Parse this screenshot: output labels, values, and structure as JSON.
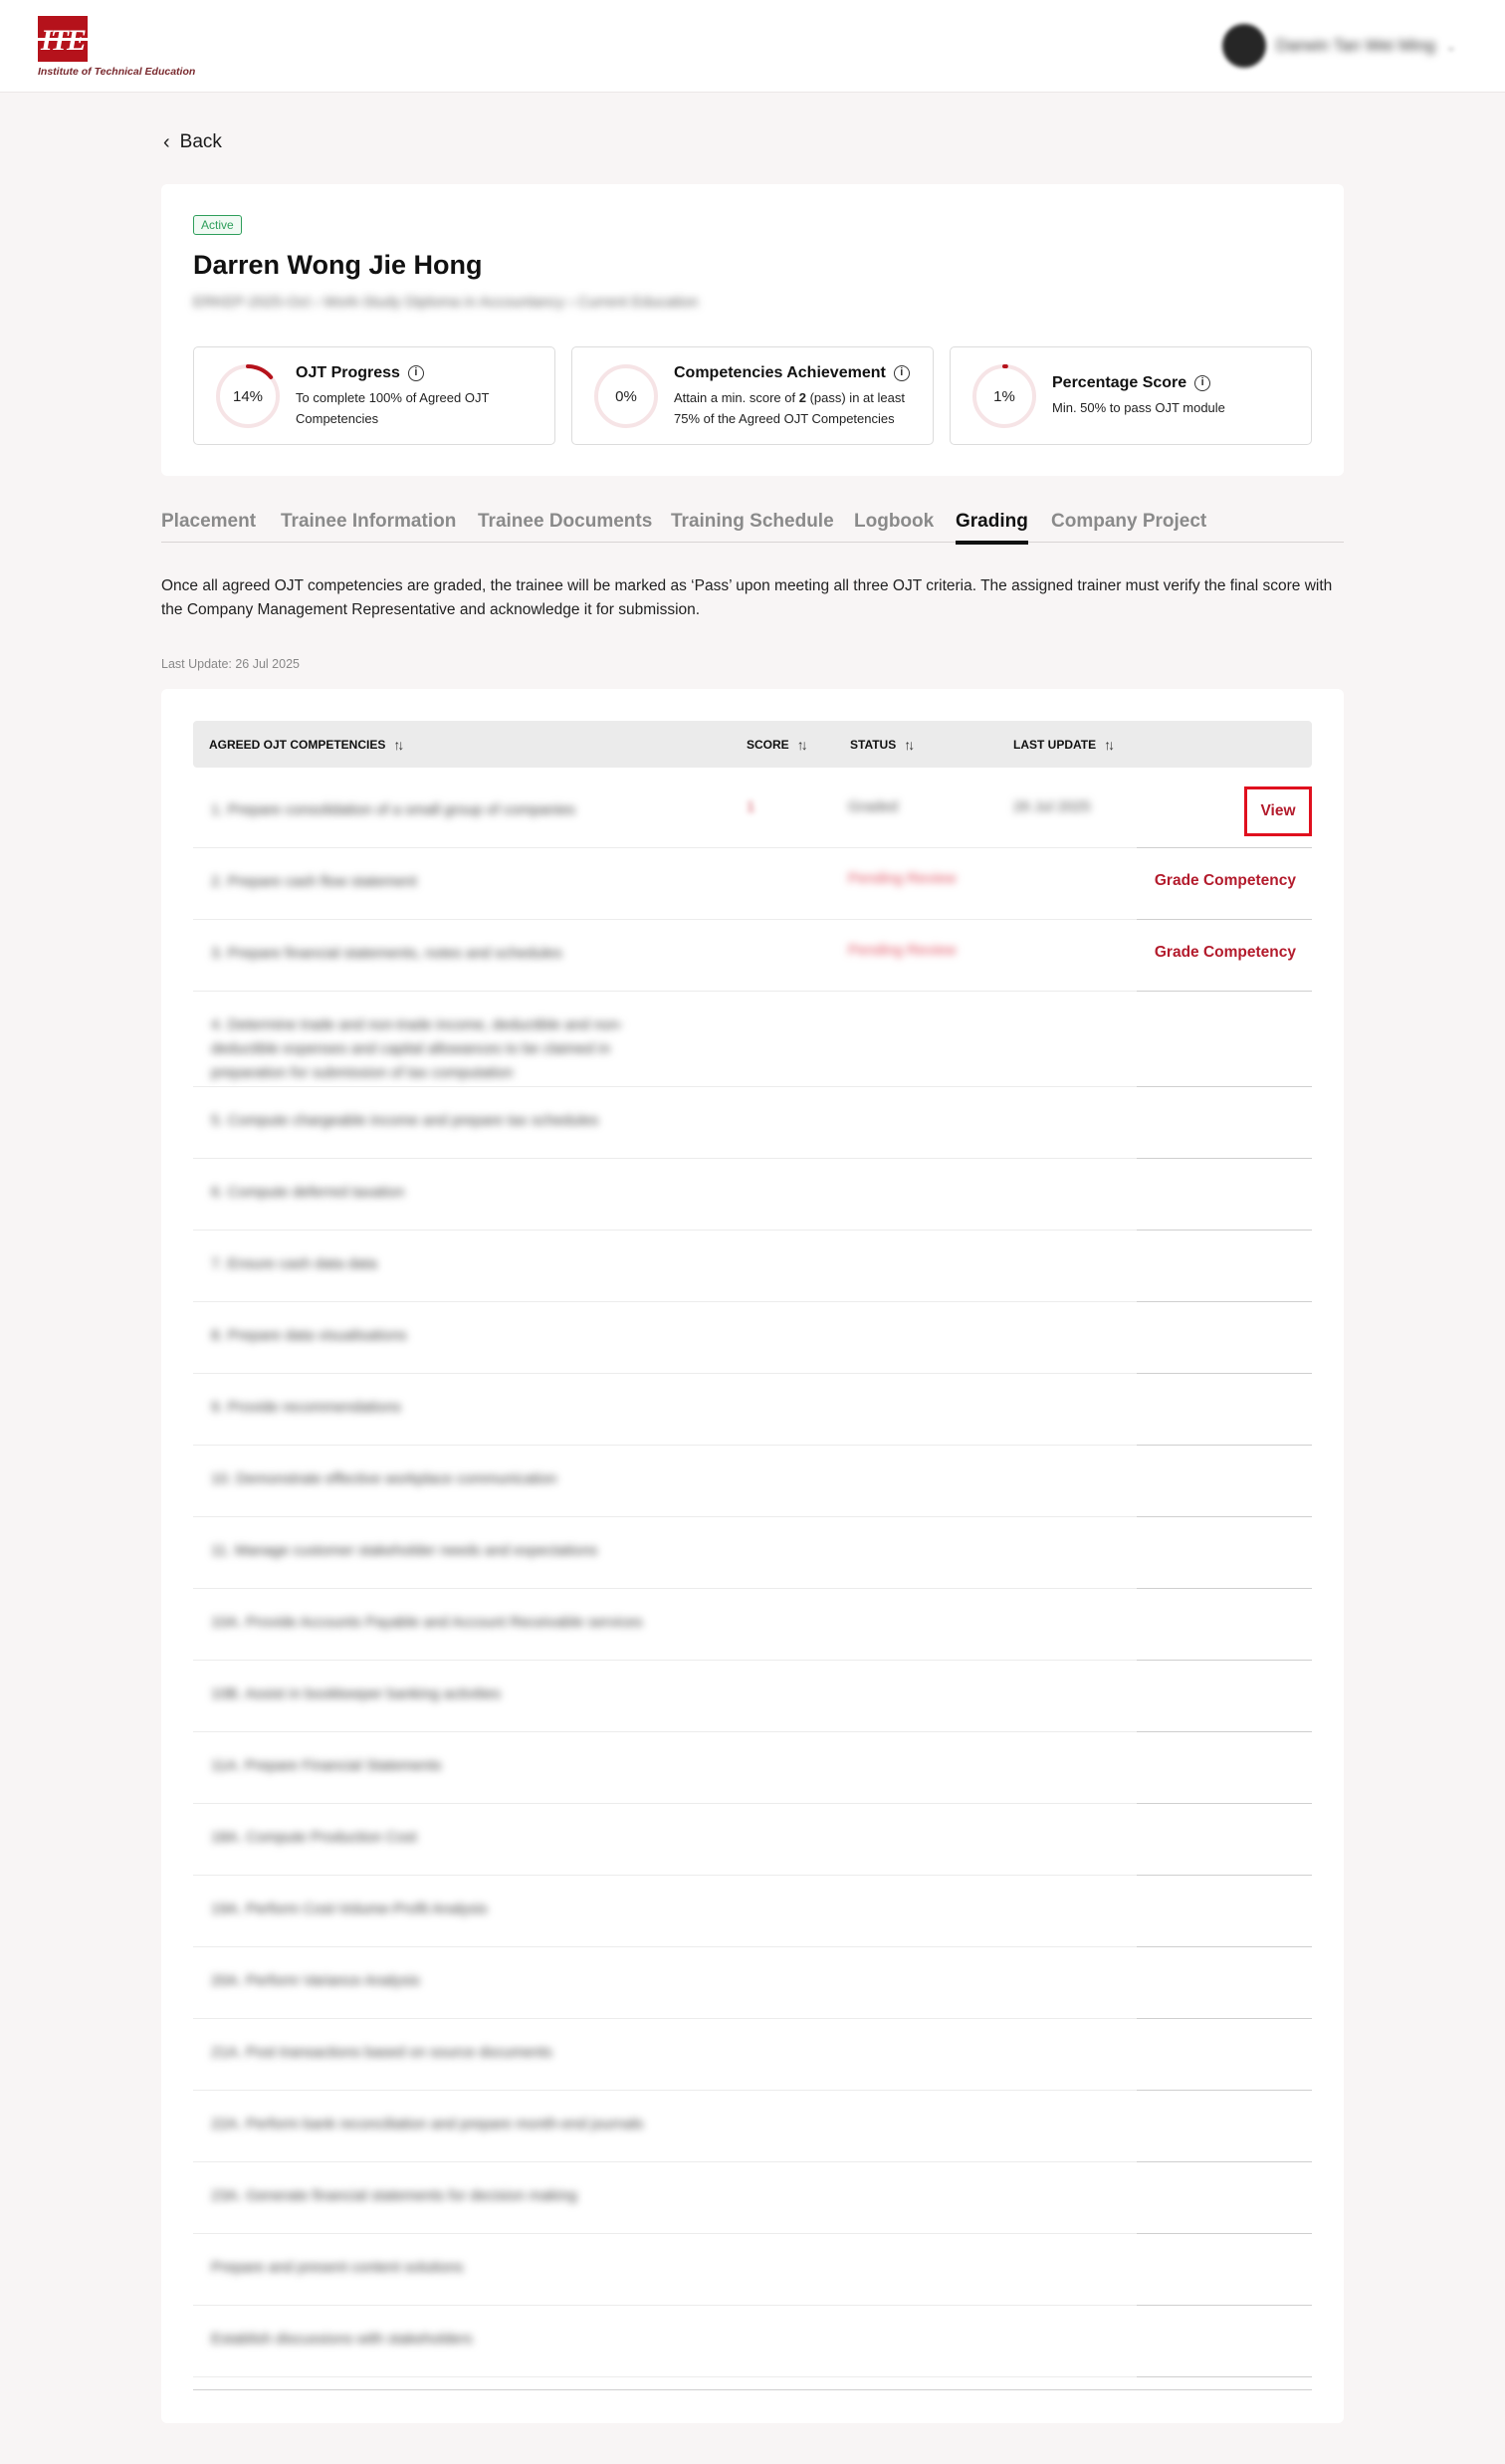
{
  "header": {
    "logo_mark": "ITE",
    "logo_text": "Institute of Technical Education",
    "user_name": "Darwin Tan Wei Ming"
  },
  "back_label": "Back",
  "profile": {
    "status_badge": "Active",
    "name": "Darren Wong Jie Hong",
    "subline": "ERKEP-2025-Oct  ›  Work-Study Diploma in Accountancy  ›  Current Education"
  },
  "stats": [
    {
      "value_label": "14%",
      "value": 14,
      "title": "OJT Progress",
      "desc": "To complete 100% of Agreed OJT Competencies"
    },
    {
      "value_label": "0%",
      "value": 0,
      "title": "Competencies Achievement",
      "desc": "Attain a min. score of 2 (pass) in at least 75% of the Agreed OJT Competencies"
    },
    {
      "value_label": "1%",
      "value": 1,
      "title": "Percentage Score",
      "desc": "Min. 50% to pass OJT module"
    }
  ],
  "tabs": [
    "Placement",
    "Trainee Information",
    "Trainee Documents",
    "Training Schedule",
    "Logbook",
    "Grading",
    "Company Project"
  ],
  "active_tab": "Grading",
  "intro_text": "Once all agreed OJT competencies are graded, the trainee will be marked as ‘Pass’ upon meeting all three OJT criteria. The assigned trainer must verify the final score with the Company Management Representative and acknowledge it for submission.",
  "last_update": "Last Update: 26 Jul 2025",
  "table": {
    "columns": [
      "AGREED OJT COMPETENCIES",
      "SCORE",
      "STATUS",
      "LAST UPDATE"
    ],
    "rows": [
      {
        "competency": "1. Prepare consolidation of a small group of companies",
        "score": "1",
        "status": "Graded",
        "last_update": "26 Jul 2025",
        "action": "View"
      },
      {
        "competency": "2. Prepare cash flow statement",
        "score": "",
        "status": "Pending Review",
        "last_update": "",
        "action": "Grade Competency"
      },
      {
        "competency": "3. Prepare financial statements, notes and schedules",
        "score": "",
        "status": "Pending Review",
        "last_update": "",
        "action": "Grade Competency"
      },
      {
        "competency": "4. Determine trade and non-trade income, deductible and non-deductible expenses and capital allowances to be claimed in preparation for submission of tax computation",
        "score": "",
        "status": "",
        "last_update": "",
        "action": ""
      },
      {
        "competency": "5. Compute chargeable income and prepare tax schedules",
        "score": "",
        "status": "",
        "last_update": "",
        "action": ""
      },
      {
        "competency": "6. Compute deferred taxation",
        "score": "",
        "status": "",
        "last_update": "",
        "action": ""
      },
      {
        "competency": "7. Ensure cash data data",
        "score": "",
        "status": "",
        "last_update": "",
        "action": ""
      },
      {
        "competency": "8. Prepare data visualisations",
        "score": "",
        "status": "",
        "last_update": "",
        "action": ""
      },
      {
        "competency": "9. Provide recommendations",
        "score": "",
        "status": "",
        "last_update": "",
        "action": ""
      },
      {
        "competency": "10. Demonstrate effective workplace communication",
        "score": "",
        "status": "",
        "last_update": "",
        "action": ""
      },
      {
        "competency": "11. Manage customer stakeholder needs and expectations",
        "score": "",
        "status": "",
        "last_update": "",
        "action": ""
      },
      {
        "competency": "10A. Provide Accounts Payable and Account Receivable services",
        "score": "",
        "status": "",
        "last_update": "",
        "action": ""
      },
      {
        "competency": "10B. Assist in bookkeeper banking activities",
        "score": "",
        "status": "",
        "last_update": "",
        "action": ""
      },
      {
        "competency": "11A. Prepare Financial Statements",
        "score": "",
        "status": "",
        "last_update": "",
        "action": ""
      },
      {
        "competency": "18A. Compute Production Cost",
        "score": "",
        "status": "",
        "last_update": "",
        "action": ""
      },
      {
        "competency": "19A. Perform Cost-Volume-Profit Analysis",
        "score": "",
        "status": "",
        "last_update": "",
        "action": ""
      },
      {
        "competency": "20A. Perform Variance Analysis",
        "score": "",
        "status": "",
        "last_update": "",
        "action": ""
      },
      {
        "competency": "21A. Post transactions based on source documents",
        "score": "",
        "status": "",
        "last_update": "",
        "action": ""
      },
      {
        "competency": "22A. Perform bank reconciliation and prepare month-end journals",
        "score": "",
        "status": "",
        "last_update": "",
        "action": ""
      },
      {
        "competency": "23A. Generate financial statements for decision making",
        "score": "",
        "status": "",
        "last_update": "",
        "action": ""
      },
      {
        "competency": "Prepare and present content solutions",
        "score": "",
        "status": "",
        "last_update": "",
        "action": ""
      },
      {
        "competency": "Establish discussions with stakeholders",
        "score": "",
        "status": "",
        "last_update": "",
        "action": ""
      }
    ]
  },
  "colors": {
    "brand": "#b5121b",
    "action": "#b31b2c",
    "ring_track": "#f6e4e6",
    "ring_fill": "#b5121b",
    "active_badge": "#2e9e5b",
    "highlight_box": "#e0101e"
  }
}
